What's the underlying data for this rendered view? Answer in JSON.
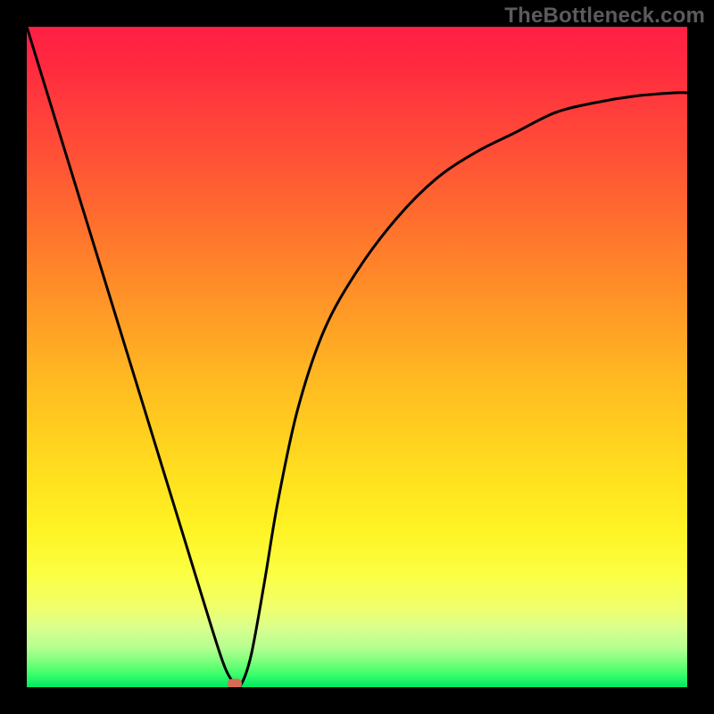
{
  "watermark": "TheBottleneck.com",
  "chart_data": {
    "type": "line",
    "title": "",
    "xlabel": "",
    "ylabel": "",
    "xlim": [
      0,
      100
    ],
    "ylim": [
      0,
      100
    ],
    "grid": false,
    "legend": false,
    "series": [
      {
        "name": "curve",
        "x": [
          0,
          4,
          8,
          12,
          16,
          20,
          24,
          28,
          30,
          31.5,
          32.5,
          34,
          36,
          38,
          41,
          45,
          50,
          56,
          62,
          68,
          74,
          80,
          86,
          92,
          98,
          100
        ],
        "y": [
          100,
          87,
          74,
          61,
          48,
          35,
          22,
          9,
          3,
          0.5,
          0.5,
          5,
          16,
          28,
          42,
          54,
          63,
          71,
          77,
          81,
          84,
          87,
          88.5,
          89.5,
          90,
          90
        ]
      }
    ],
    "marker": {
      "x": 31.5,
      "y": 0.5,
      "color": "#d86a56"
    },
    "background_gradient": {
      "stops": [
        {
          "pos": 0,
          "color": "#ff1f45"
        },
        {
          "pos": 20,
          "color": "#ff5236"
        },
        {
          "pos": 44,
          "color": "#ff9c26"
        },
        {
          "pos": 68,
          "color": "#ffe01f"
        },
        {
          "pos": 88,
          "color": "#f0ff6c"
        },
        {
          "pos": 100,
          "color": "#00e765"
        }
      ]
    }
  }
}
